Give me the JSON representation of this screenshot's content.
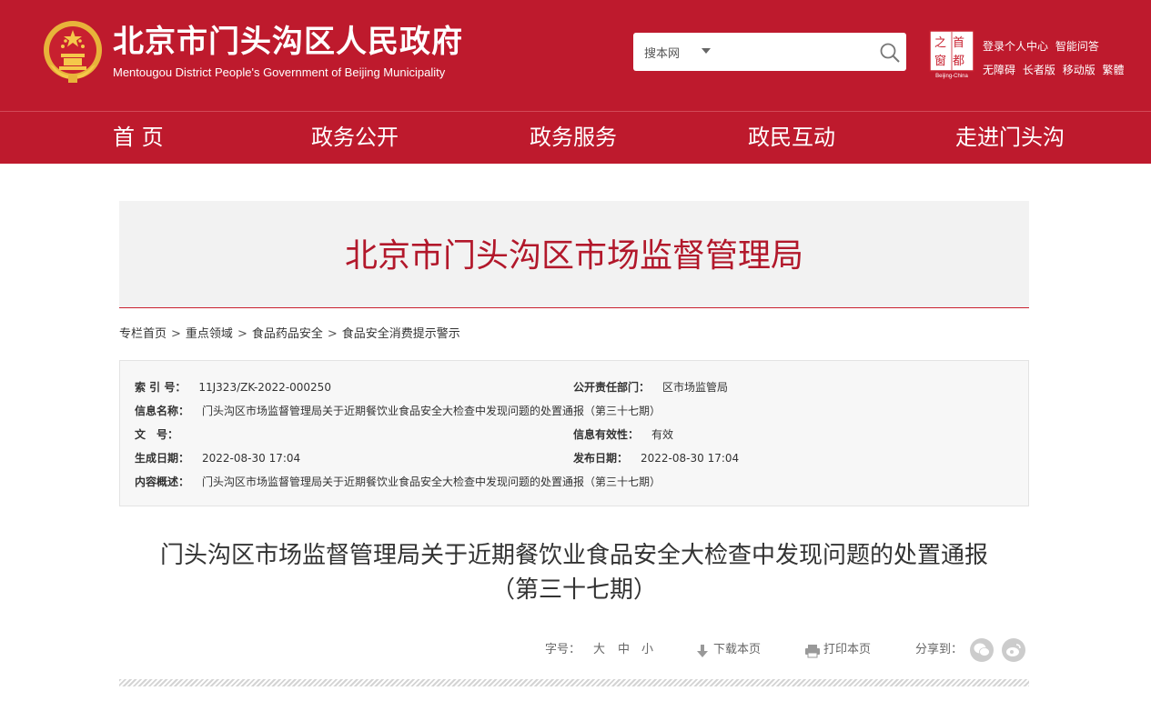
{
  "header": {
    "title": "北京市门头沟区人民政府",
    "subtitle": "Mentougou District People's Government of Beijing Municipality",
    "search": {
      "scope": "搜本网",
      "placeholder": ""
    },
    "capital_logo_text": "Beijing-China",
    "links_row1": [
      "登录个人中心",
      "智能问答"
    ],
    "links_row2": [
      "无障碍",
      "长者版",
      "移动版",
      "繁體"
    ]
  },
  "nav": {
    "items": [
      "首 页",
      "政务公开",
      "政务服务",
      "政民互动",
      "走进门头沟"
    ]
  },
  "banner": {
    "title": "北京市门头沟区市场监督管理局"
  },
  "breadcrumb": [
    "专栏首页",
    "重点领域",
    "食品药品安全",
    "食品安全消费提示警示"
  ],
  "info": {
    "index_label": "索 引 号：",
    "index_value": "11J323/ZK-2022-000250",
    "dept_label": "公开责任部门：",
    "dept_value": "区市场监管局",
    "name_label": "信息名称：",
    "name_value": "门头沟区市场监督管理局关于近期餐饮业食品安全大检查中发现问题的处置通报（第三十七期）",
    "doc_label": "文　号：",
    "doc_value": "",
    "validity_label": "信息有效性：",
    "validity_value": "有效",
    "created_label": "生成日期：",
    "created_value": "2022-08-30 17:04",
    "published_label": "发布日期：",
    "published_value": "2022-08-30 17:04",
    "summary_label": "内容概述：",
    "summary_value": "门头沟区市场监督管理局关于近期餐饮业食品安全大检查中发现问题的处置通报（第三十七期）"
  },
  "article": {
    "title_line1": "门头沟区市场监督管理局关于近期餐饮业食品安全大检查中发现问题的处置通报",
    "title_line2": "（第三十七期）"
  },
  "tools": {
    "font_label": "字号：",
    "font_large": "大",
    "font_medium": "中",
    "font_small": "小",
    "download": "下载本页",
    "print": "打印本页",
    "share": "分享到："
  },
  "colors": {
    "brand_red": "#be1a2d",
    "banner_text": "#b2182b"
  }
}
